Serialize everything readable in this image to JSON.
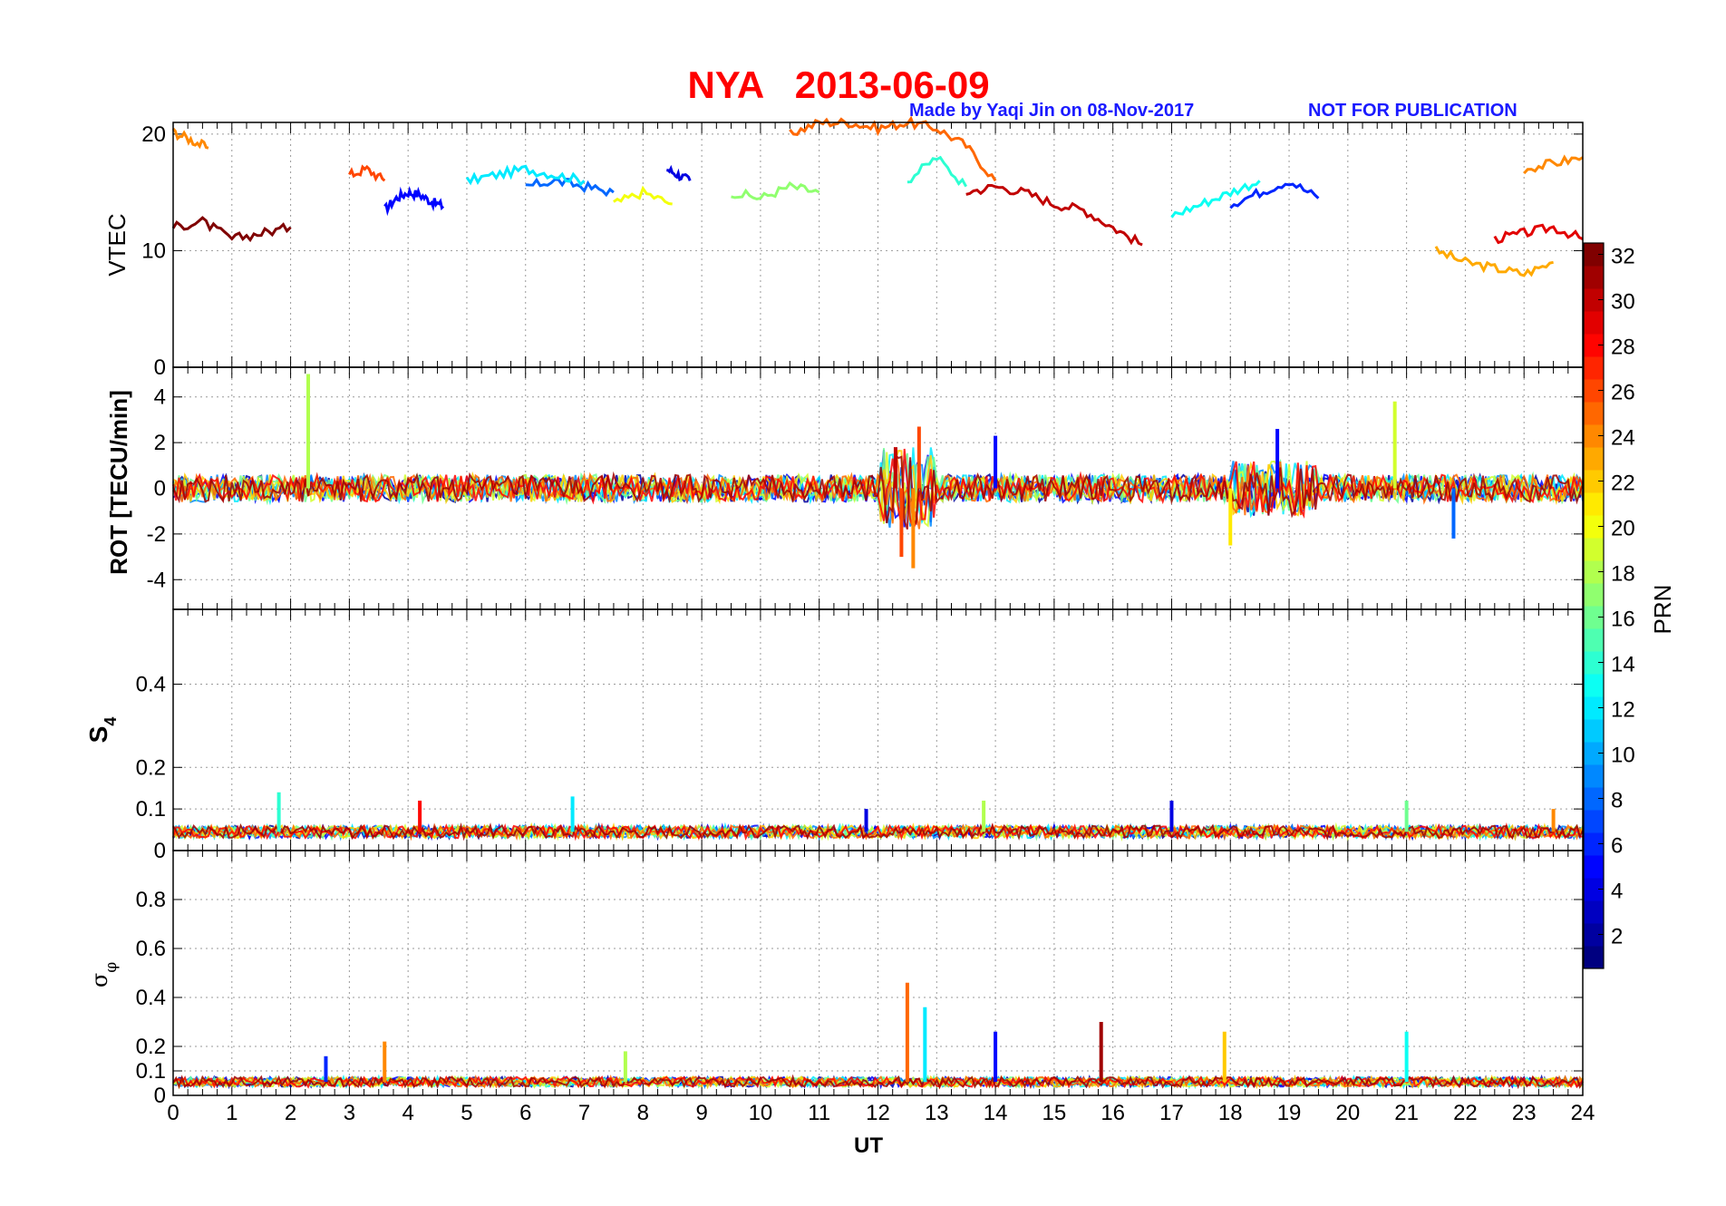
{
  "header": {
    "title": "NYA   2013-06-09",
    "credit": "Made by Yaqi Jin on 08-Nov-2017",
    "notice": "NOT FOR PUBLICATION"
  },
  "colors": {
    "title": "#ff0000",
    "credit": "#1a1aff"
  },
  "chart_data": [
    {
      "type": "line",
      "panel": "vtec",
      "ylabel": "VTEC",
      "xlim": [
        0,
        24
      ],
      "ylim": [
        0,
        21
      ],
      "yticks": [
        0,
        10,
        20
      ],
      "grid": true,
      "series": [
        {
          "prn": 5,
          "x": [
            3.6,
            3.8,
            4.0,
            4.2,
            4.4,
            4.6
          ],
          "y": [
            13.5,
            14.5,
            15.0,
            14.8,
            14.2,
            13.8
          ]
        },
        {
          "prn": 4,
          "x": [
            8.4,
            8.6,
            8.8
          ],
          "y": [
            17.0,
            16.5,
            16.0
          ]
        },
        {
          "prn": 8,
          "x": [
            6.0,
            6.5,
            7.0,
            7.5
          ],
          "y": [
            15.5,
            16.0,
            15.5,
            15.0
          ]
        },
        {
          "prn": 12,
          "x": [
            5.0,
            5.5,
            6.0,
            6.5,
            7.0
          ],
          "y": [
            16.0,
            16.5,
            17.0,
            16.5,
            16.0
          ]
        },
        {
          "prn": 14,
          "x": [
            12.5,
            13.0,
            13.5
          ],
          "y": [
            16.0,
            18.0,
            15.5
          ]
        },
        {
          "prn": 17,
          "x": [
            9.5,
            10.0,
            10.5,
            11.0
          ],
          "y": [
            15.0,
            14.5,
            15.5,
            15.0
          ]
        },
        {
          "prn": 20,
          "x": [
            7.5,
            8.0,
            8.5
          ],
          "y": [
            14.0,
            15.0,
            14.0
          ]
        },
        {
          "prn": 24,
          "x": [
            0.0,
            0.3,
            0.6
          ],
          "y": [
            20.2,
            19.5,
            18.8
          ]
        },
        {
          "prn": 25,
          "x": [
            10.5,
            11.0,
            11.5,
            12.0,
            12.5,
            13.0,
            13.5,
            14.0
          ],
          "y": [
            20.0,
            21.0,
            21.0,
            20.5,
            21.0,
            20.5,
            19.0,
            16.0
          ]
        },
        {
          "prn": 26,
          "x": [
            3.0,
            3.3,
            3.6
          ],
          "y": [
            16.5,
            17.0,
            16.0
          ]
        },
        {
          "prn": 30,
          "x": [
            13.5,
            14.0,
            14.5,
            15.0,
            15.5,
            16.0,
            16.5
          ],
          "y": [
            15.0,
            15.5,
            15.0,
            14.0,
            13.5,
            12.0,
            10.5
          ]
        },
        {
          "prn": 32,
          "x": [
            0.0,
            0.5,
            1.0,
            1.5,
            2.0
          ],
          "y": [
            12.0,
            12.5,
            11.0,
            11.5,
            12.0
          ]
        },
        {
          "prn": 6,
          "x": [
            18.0,
            18.5,
            19.0,
            19.5
          ],
          "y": [
            14.0,
            15.0,
            16.0,
            14.5
          ]
        },
        {
          "prn": 13,
          "x": [
            17.0,
            17.5,
            18.0,
            18.5
          ],
          "y": [
            13.0,
            14.0,
            15.0,
            16.0
          ]
        },
        {
          "prn": 23,
          "x": [
            21.5,
            22.0,
            22.5,
            23.0,
            23.5
          ],
          "y": [
            10.0,
            9.0,
            8.5,
            8.0,
            9.0
          ]
        },
        {
          "prn": 24,
          "x": [
            23.0,
            23.5,
            24.0
          ],
          "y": [
            17.0,
            17.5,
            18.0
          ]
        },
        {
          "prn": 29,
          "x": [
            22.5,
            23.0,
            23.5,
            24.0
          ],
          "y": [
            11.0,
            11.5,
            12.0,
            11.0
          ]
        }
      ]
    },
    {
      "type": "line",
      "panel": "rot",
      "ylabel": "ROT [TECU/min]",
      "xlim": [
        0,
        24
      ],
      "ylim": [
        -5.3,
        5.3
      ],
      "yticks": [
        -4,
        -2,
        0,
        2,
        4
      ],
      "grid": true,
      "note": "Values fluctuate around 0 across all PRNs; notable peaks listed below",
      "peaks": [
        {
          "prn": 18,
          "x": 2.3,
          "y": 5.0
        },
        {
          "prn": 24,
          "x": 12.6,
          "y": -3.5
        },
        {
          "prn": 26,
          "x": 12.4,
          "y": -3.0
        },
        {
          "prn": 26,
          "x": 12.7,
          "y": 2.7
        },
        {
          "prn": 30,
          "x": 12.3,
          "y": 1.8
        },
        {
          "prn": 5,
          "x": 14.0,
          "y": 2.3
        },
        {
          "prn": 5,
          "x": 18.8,
          "y": 2.6
        },
        {
          "prn": 19,
          "x": 20.8,
          "y": 3.8
        },
        {
          "prn": 21,
          "x": 18.0,
          "y": -2.5
        },
        {
          "prn": 8,
          "x": 21.8,
          "y": -2.2
        }
      ]
    },
    {
      "type": "line",
      "panel": "s4",
      "ylabel": "S4",
      "xlim": [
        0,
        24
      ],
      "ylim": [
        0,
        0.58
      ],
      "yticks": [
        0,
        0.1,
        0.2,
        0.4
      ],
      "grid": true,
      "note": "Baseline about 0.03-0.06 for all PRNs",
      "peaks": [
        {
          "prn": 14,
          "x": 1.8,
          "y": 0.14
        },
        {
          "prn": 28,
          "x": 4.2,
          "y": 0.12
        },
        {
          "prn": 12,
          "x": 6.8,
          "y": 0.13
        },
        {
          "prn": 4,
          "x": 11.8,
          "y": 0.1
        },
        {
          "prn": 18,
          "x": 13.8,
          "y": 0.12
        },
        {
          "prn": 4,
          "x": 17.0,
          "y": 0.12
        },
        {
          "prn": 16,
          "x": 21.0,
          "y": 0.12
        },
        {
          "prn": 24,
          "x": 23.5,
          "y": 0.1
        }
      ]
    },
    {
      "type": "line",
      "panel": "sigma_phi",
      "ylabel": "σφ",
      "xlim": [
        0,
        24
      ],
      "xlabel": "UT",
      "xticks": [
        0,
        1,
        2,
        3,
        4,
        5,
        6,
        7,
        8,
        9,
        10,
        11,
        12,
        13,
        14,
        15,
        16,
        17,
        18,
        19,
        20,
        21,
        22,
        23,
        24
      ],
      "ylim": [
        0,
        1.0
      ],
      "yticks": [
        0,
        0.1,
        0.2,
        0.4,
        0.6,
        0.8
      ],
      "grid": true,
      "note": "Baseline about 0.05 for all PRNs",
      "peaks": [
        {
          "prn": 6,
          "x": 2.6,
          "y": 0.16
        },
        {
          "prn": 24,
          "x": 3.6,
          "y": 0.22
        },
        {
          "prn": 18,
          "x": 7.7,
          "y": 0.18
        },
        {
          "prn": 25,
          "x": 12.5,
          "y": 0.46
        },
        {
          "prn": 12,
          "x": 12.8,
          "y": 0.36
        },
        {
          "prn": 5,
          "x": 14.0,
          "y": 0.26
        },
        {
          "prn": 31,
          "x": 15.8,
          "y": 0.3
        },
        {
          "prn": 22,
          "x": 17.9,
          "y": 0.26
        },
        {
          "prn": 13,
          "x": 21.0,
          "y": 0.26
        }
      ]
    }
  ],
  "colorbar": {
    "label": "PRN",
    "ticks": [
      2,
      4,
      6,
      8,
      10,
      12,
      14,
      16,
      18,
      20,
      22,
      24,
      26,
      28,
      30,
      32
    ],
    "range": [
      1,
      32
    ],
    "colormap": "jet"
  }
}
